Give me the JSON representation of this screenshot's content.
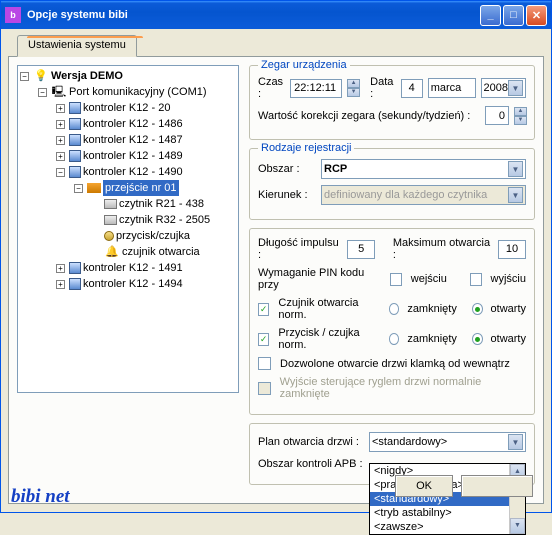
{
  "window": {
    "title": "Opcje systemu bibi"
  },
  "tab": {
    "label": "Ustawienia systemu"
  },
  "tree": {
    "root": "Wersja DEMO",
    "port": "Port komunikacyjny (COM1)",
    "k": [
      "kontroler K12 - 20",
      "kontroler K12 - 1486",
      "kontroler K12 - 1487",
      "kontroler K12 - 1489",
      "kontroler K12 - 1490",
      "kontroler K12 - 1491",
      "kontroler K12 - 1494"
    ],
    "pass": "przejście nr 01",
    "leaves": [
      "czytnik R21 - 438",
      "czytnik R32 - 2505",
      "przycisk/czujka",
      "czujnik otwarcia"
    ]
  },
  "clock": {
    "legend": "Zegar urządzenia",
    "time_lbl": "Czas :",
    "time": "22:12:11",
    "date_lbl": "Data :",
    "day": "4",
    "month": "marca",
    "year": "2008",
    "corr_lbl": "Wartość korekcji zegara (sekundy/tydzień) :",
    "corr": "0"
  },
  "reg": {
    "legend": "Rodzaje rejestracji",
    "area_lbl": "Obszar :",
    "area": "RCP",
    "dir_lbl": "Kierunek :",
    "dir": "definiowany dla każdego czytnika"
  },
  "pulse": {
    "len_lbl": "Długość impulsu :",
    "len": "5",
    "max_lbl": "Maksimum otwarcia :",
    "max": "10"
  },
  "pin": {
    "legend": "Wymaganie PIN kodu przy",
    "in": "wejściu",
    "out": "wyjściu",
    "sensor": "Czujnik otwarcia norm.",
    "closed": "zamknięty",
    "open": "otwarty",
    "button": "Przycisk / czujka norm.",
    "handle": "Dozwolone otwarcie drzwi klamką od wewnątrz",
    "lock": "Wyjście sterujące ryglem drzwi normalnie zamknięte"
  },
  "plan": {
    "lbl": "Plan otwarcia drzwi :",
    "val": "<standardowy>"
  },
  "apb": {
    "lbl": "Obszar kontroli APB :",
    "opts": [
      "<nigdy>",
      "<praca bistabilna>",
      "<standardowy>",
      "<tryb astabilny>",
      "<zawsze>"
    ]
  },
  "buttons": {
    "ok": "OK"
  },
  "logo": "bibi net",
  "chart_data": null
}
